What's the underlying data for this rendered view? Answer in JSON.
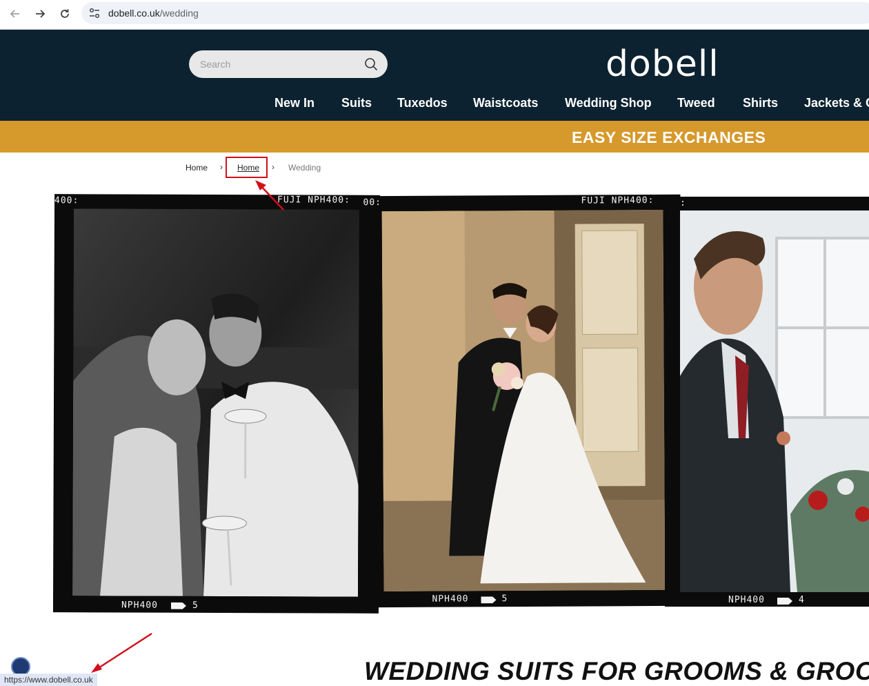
{
  "browser": {
    "url_host": "dobell.co.uk",
    "url_path": "/wedding"
  },
  "header": {
    "search_placeholder": "Search",
    "logo": "dobell",
    "nav": [
      "New In",
      "Suits",
      "Tuxedos",
      "Waistcoats",
      "Wedding Shop",
      "Tweed",
      "Shirts",
      "Jackets & C"
    ]
  },
  "promo": {
    "text": "EASY SIZE EXCHANGES"
  },
  "breadcrumb": {
    "items": [
      "Home",
      "Home",
      "Wedding"
    ]
  },
  "film_strip": {
    "frames": [
      {
        "top_left": "400:",
        "top_right": "FUJI NPH400:",
        "bottom": "NPH400",
        "frame_no": "5"
      },
      {
        "top_left": "00:",
        "top_right": "FUJI NPH400:",
        "bottom": "NPH400",
        "frame_no": "5"
      },
      {
        "top_left": ":",
        "top_right": "",
        "bottom": "NPH400",
        "frame_no": "4"
      }
    ]
  },
  "page": {
    "heading": "WEDDING SUITS FOR GROOMS & GROOMS"
  },
  "status_bar": {
    "url": "https://www.dobell.co.uk"
  },
  "colors": {
    "header_bg": "#0c2230",
    "promo_bg": "#d6992c",
    "annotation": "#d10f1a"
  }
}
